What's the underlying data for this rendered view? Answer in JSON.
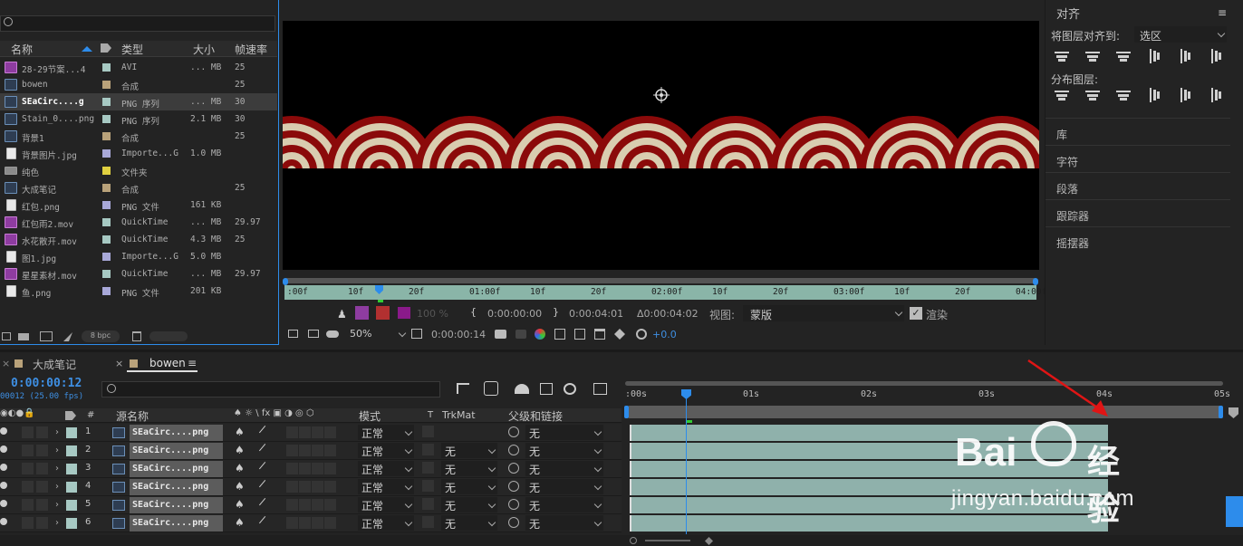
{
  "project": {
    "search_placeholder": "",
    "columns": {
      "name": "名称",
      "type": "类型",
      "size": "大小",
      "fps": "帧速率"
    },
    "items": [
      {
        "name": "28-29节案...4",
        "type": "AVI",
        "size": "... MB",
        "fps": "25",
        "icon": "video-file-icon",
        "label_color": "#a7c9c3"
      },
      {
        "name": "bowen",
        "type": "合成",
        "size": "",
        "fps": "25",
        "icon": "composition-icon",
        "label_color": "#b9a27a"
      },
      {
        "name": "SEaCirc....g",
        "type": "PNG 序列",
        "size": "... MB",
        "fps": "30",
        "icon": "image-sequence-icon",
        "label_color": "#a7c9c3",
        "selected": true
      },
      {
        "name": "Stain_0....png",
        "type": "PNG 序列",
        "size": "2.1 MB",
        "fps": "30",
        "icon": "image-sequence-icon",
        "label_color": "#a7c9c3"
      },
      {
        "name": "背景1",
        "type": "合成",
        "size": "",
        "fps": "25",
        "icon": "composition-icon",
        "label_color": "#b9a27a"
      },
      {
        "name": "背景图片.jpg",
        "type": "Importe...G",
        "size": "1.0 MB",
        "fps": "",
        "icon": "image-file-icon",
        "label_color": "#a8a8d8"
      },
      {
        "name": "纯色",
        "type": "文件夹",
        "size": "",
        "fps": "",
        "icon": "folder-icon",
        "label_color": "#e0d040"
      },
      {
        "name": "大成笔记",
        "type": "合成",
        "size": "",
        "fps": "25",
        "icon": "composition-icon",
        "label_color": "#b9a27a"
      },
      {
        "name": "红包.png",
        "type": "PNG 文件",
        "size": "161 KB",
        "fps": "",
        "icon": "image-file-icon",
        "label_color": "#a8a8d8"
      },
      {
        "name": "红包雨2.mov",
        "type": "QuickTime",
        "size": "... MB",
        "fps": "29.97",
        "icon": "movie-file-icon",
        "label_color": "#a7c9c3"
      },
      {
        "name": "水花散开.mov",
        "type": "QuickTime",
        "size": "4.3 MB",
        "fps": "25",
        "icon": "movie-file-icon",
        "label_color": "#a7c9c3"
      },
      {
        "name": "图1.jpg",
        "type": "Importe...G",
        "size": "5.0 MB",
        "fps": "",
        "icon": "image-file-icon",
        "label_color": "#a8a8d8"
      },
      {
        "name": "星星素材.mov",
        "type": "QuickTime",
        "size": "... MB",
        "fps": "29.97",
        "icon": "movie-file-icon",
        "label_color": "#a7c9c3"
      },
      {
        "name": "鱼.png",
        "type": "PNG 文件",
        "size": "201 KB",
        "fps": "",
        "icon": "image-file-icon",
        "label_color": "#a8a8d8"
      }
    ],
    "bpc": "8 bpc"
  },
  "viewer": {
    "ruler_ticks": [
      ":00f",
      "10f",
      "20f",
      "01:00f",
      "10f",
      "20f",
      "02:00f",
      "10f",
      "20f",
      "03:00f",
      "10f",
      "20f",
      "04:00f"
    ],
    "opacity": "100 %",
    "in_point": "0:00:00:00",
    "out_point": "0:00:04:01",
    "duration": "Δ0:00:04:02",
    "view_label": "视图:",
    "view_value": "蒙版",
    "render_label": "渲染",
    "zoom": "50%",
    "current_time": "0:00:00:14",
    "exposure": "+0.0"
  },
  "align": {
    "title": "对齐",
    "align_to_label": "将图层对齐到:",
    "align_to_value": "选区",
    "distribute_label": "分布图层:",
    "panels": [
      "库",
      "字符",
      "段落",
      "跟踪器",
      "摇摆器"
    ]
  },
  "timeline": {
    "tabs": [
      {
        "label": "大成笔记",
        "active": false
      },
      {
        "label": "bowen",
        "active": true
      }
    ],
    "timecode": "0:00:00:12",
    "fps_info": "00012 (25.00 fps)",
    "headers": {
      "hash": "#",
      "source": "源名称",
      "mode": "模式",
      "t": "T",
      "trkmat": "TrkMat",
      "parent": "父级和链接"
    },
    "time_ticks": [
      ":00s",
      "01s",
      "02s",
      "03s",
      "04s",
      "05s"
    ],
    "layers": [
      {
        "num": "1",
        "name": "SEaCirc....png",
        "mode": "正常",
        "trkmat": "",
        "parent": "无"
      },
      {
        "num": "2",
        "name": "SEaCirc....png",
        "mode": "正常",
        "trkmat": "无",
        "parent": "无"
      },
      {
        "num": "3",
        "name": "SEaCirc....png",
        "mode": "正常",
        "trkmat": "无",
        "parent": "无"
      },
      {
        "num": "4",
        "name": "SEaCirc....png",
        "mode": "正常",
        "trkmat": "无",
        "parent": "无"
      },
      {
        "num": "5",
        "name": "SEaCirc....png",
        "mode": "正常",
        "trkmat": "无",
        "parent": "无"
      },
      {
        "num": "6",
        "name": "SEaCirc....png",
        "mode": "正常",
        "trkmat": "无",
        "parent": "无"
      }
    ]
  },
  "watermark": {
    "brand": "Bai",
    "brand2": "经验",
    "url": "jingyan.baidu.com"
  },
  "colors": {
    "accent": "#2d8ceb",
    "layer_bar": "#8fb1ab",
    "timecode": "#3e8fe3",
    "wave_red": "#8b0a0a",
    "wave_cream": "#d9cdb0"
  }
}
